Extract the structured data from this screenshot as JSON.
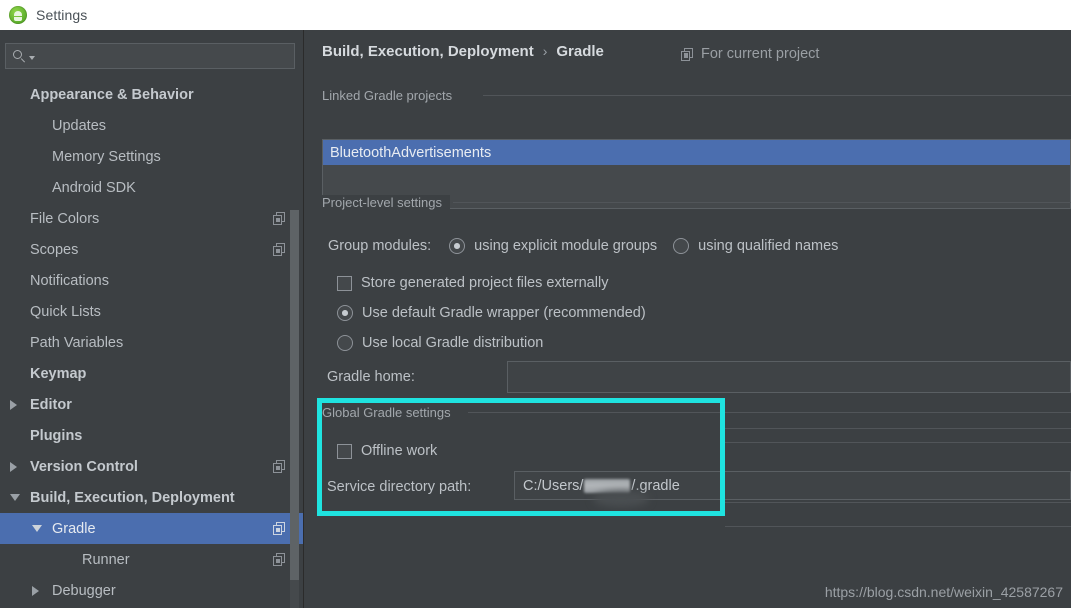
{
  "window": {
    "title": "Settings",
    "app_icon": "android-studio-icon"
  },
  "sidebar": {
    "search": {
      "value": "",
      "placeholder": "",
      "icon": "search-icon"
    },
    "items": [
      {
        "label": "Appearance & Behavior",
        "indent": 0,
        "bold": true,
        "arrow": "none",
        "copy": false,
        "selected": false
      },
      {
        "label": "Updates",
        "indent": 1,
        "bold": false,
        "arrow": "none",
        "copy": false,
        "selected": false
      },
      {
        "label": "Memory Settings",
        "indent": 1,
        "bold": false,
        "arrow": "none",
        "copy": false,
        "selected": false
      },
      {
        "label": "Android SDK",
        "indent": 1,
        "bold": false,
        "arrow": "none",
        "copy": false,
        "selected": false
      },
      {
        "label": "File Colors",
        "indent": 0,
        "bold": false,
        "arrow": "none",
        "copy": true,
        "selected": false
      },
      {
        "label": "Scopes",
        "indent": 0,
        "bold": false,
        "arrow": "none",
        "copy": true,
        "selected": false
      },
      {
        "label": "Notifications",
        "indent": 0,
        "bold": false,
        "arrow": "none",
        "copy": false,
        "selected": false
      },
      {
        "label": "Quick Lists",
        "indent": 0,
        "bold": false,
        "arrow": "none",
        "copy": false,
        "selected": false
      },
      {
        "label": "Path Variables",
        "indent": 0,
        "bold": false,
        "arrow": "none",
        "copy": false,
        "selected": false
      },
      {
        "label": "Keymap",
        "indent": 0,
        "bold": true,
        "arrow": "none",
        "copy": false,
        "selected": false
      },
      {
        "label": "Editor",
        "indent": 0,
        "bold": true,
        "arrow": "right",
        "copy": false,
        "selected": false
      },
      {
        "label": "Plugins",
        "indent": 0,
        "bold": true,
        "arrow": "none",
        "copy": false,
        "selected": false
      },
      {
        "label": "Version Control",
        "indent": 0,
        "bold": true,
        "arrow": "right",
        "copy": true,
        "selected": false
      },
      {
        "label": "Build, Execution, Deployment",
        "indent": 0,
        "bold": true,
        "arrow": "down",
        "copy": false,
        "selected": false
      },
      {
        "label": "Gradle",
        "indent": 1,
        "bold": false,
        "arrow": "down",
        "copy": true,
        "selected": true
      },
      {
        "label": "Runner",
        "indent": 2,
        "bold": false,
        "arrow": "none",
        "copy": true,
        "selected": false
      },
      {
        "label": "Debugger",
        "indent": 1,
        "bold": false,
        "arrow": "right",
        "copy": false,
        "selected": false
      }
    ]
  },
  "main": {
    "breadcrumb": {
      "parent": "Build, Execution, Deployment",
      "separator": "›",
      "current": "Gradle"
    },
    "for_current_project": {
      "label": "For current project",
      "icon": "copy-icon"
    },
    "linked_projects": {
      "group_title": "Linked Gradle projects",
      "items": [
        "BluetoothAdvertisements"
      ],
      "selected_index": 0
    },
    "project_level": {
      "group_title": "Project-level settings",
      "group_modules_label": "Group modules:",
      "group_modules_options": [
        {
          "label": "using explicit module groups",
          "checked": true
        },
        {
          "label": "using qualified names",
          "checked": false
        }
      ],
      "store_generated": {
        "label": "Store generated project files externally",
        "checked": false
      },
      "distribution_options": [
        {
          "label": "Use default Gradle wrapper (recommended)",
          "checked": true
        },
        {
          "label": "Use local Gradle distribution",
          "checked": false
        }
      ],
      "gradle_home_label": "Gradle home:",
      "gradle_home_value": ""
    },
    "global_settings": {
      "group_title": "Global Gradle settings",
      "offline_work": {
        "label": "Offline work",
        "checked": false
      },
      "service_directory_label": "Service directory path:",
      "service_directory_prefix": "C:/Users/",
      "service_directory_suffix": "/.gradle",
      "highlight_color": "#1fe3e0"
    },
    "watermark": "https://blog.csdn.net/weixin_42587267"
  }
}
